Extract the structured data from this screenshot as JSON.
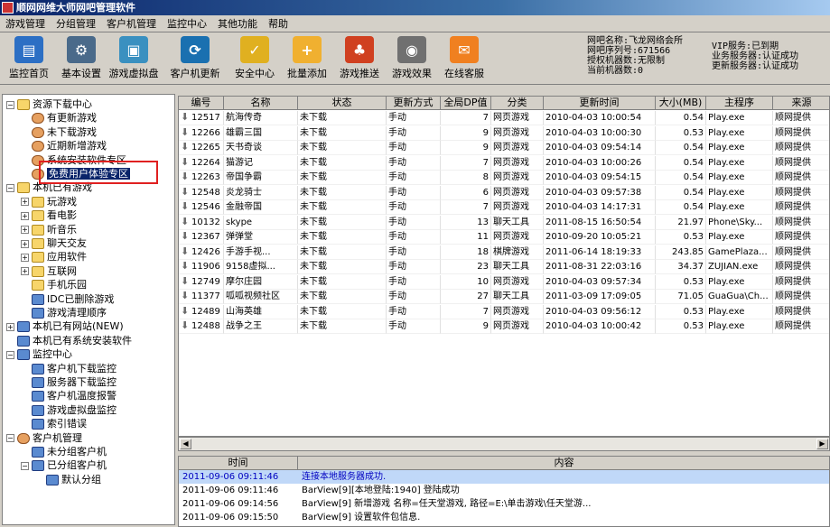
{
  "window": {
    "title": "顺网网维大师网吧管理软件"
  },
  "menu": [
    "游戏管理",
    "分组管理",
    "客户机管理",
    "监控中心",
    "其他功能",
    "帮助"
  ],
  "toolbar": [
    {
      "label": "监控首页",
      "icon": "monitor-chart-icon",
      "color": "#2c6fc4"
    },
    {
      "label": "基本设置",
      "icon": "gear-icon",
      "color": "#4a6a8a"
    },
    {
      "label": "游戏虚拟盘",
      "icon": "disk-icon",
      "color": "#3a90c0"
    },
    {
      "label": "客户机更新",
      "icon": "screen-refresh-icon",
      "color": "#1a70b0"
    },
    {
      "label": "安全中心",
      "icon": "shield-icon",
      "color": "#e0b020"
    },
    {
      "label": "批量添加",
      "icon": "folder-add-icon",
      "color": "#f0b030"
    },
    {
      "label": "游戏推送",
      "icon": "mushroom-icon",
      "color": "#d04020"
    },
    {
      "label": "游戏效果",
      "icon": "gamepad-icon",
      "color": "#707070"
    },
    {
      "label": "在线客服",
      "icon": "chat-icon",
      "color": "#f08020"
    }
  ],
  "info_left": [
    "网吧名称:飞龙网络会所",
    "网吧序列号:671566",
    "授权机器数:无限制",
    "当前机器数:0"
  ],
  "info_right": [
    "VIP服务:已到期",
    "业务服务器:认证成功",
    "更新服务器:认证成功"
  ],
  "tree": {
    "nodes": [
      {
        "label": "资源下载中心",
        "level": 0,
        "exp": "−",
        "icon": "folder"
      },
      {
        "label": "有更新游戏",
        "level": 1,
        "icon": "person"
      },
      {
        "label": "未下载游戏",
        "level": 1,
        "icon": "person"
      },
      {
        "label": "近期新增游戏",
        "level": 1,
        "icon": "person"
      },
      {
        "label": "系统安装软件专区",
        "level": 1,
        "icon": "person"
      },
      {
        "label": "免费用户体验专区",
        "level": 1,
        "icon": "person",
        "selected": true
      },
      {
        "label": "本机已有游戏",
        "level": 0,
        "exp": "−",
        "icon": "folder"
      },
      {
        "label": "玩游戏",
        "level": 1,
        "exp": "+",
        "icon": "folder"
      },
      {
        "label": "看电影",
        "level": 1,
        "exp": "+",
        "icon": "folder"
      },
      {
        "label": "听音乐",
        "level": 1,
        "exp": "+",
        "icon": "folder"
      },
      {
        "label": "聊天交友",
        "level": 1,
        "exp": "+",
        "icon": "folder"
      },
      {
        "label": "应用软件",
        "level": 1,
        "exp": "+",
        "icon": "folder"
      },
      {
        "label": "互联网",
        "level": 1,
        "exp": "+",
        "icon": "folder"
      },
      {
        "label": "手机乐园",
        "level": 1,
        "icon": "folder"
      },
      {
        "label": "IDC已删除游戏",
        "level": 1,
        "icon": "monitor"
      },
      {
        "label": "游戏清理顺序",
        "level": 1,
        "icon": "monitor"
      },
      {
        "label": "本机已有网站(NEW)",
        "level": 0,
        "exp": "+",
        "icon": "monitor"
      },
      {
        "label": "本机已有系统安装软件",
        "level": 0,
        "icon": "monitor"
      },
      {
        "label": "监控中心",
        "level": 0,
        "exp": "−",
        "icon": "monitor"
      },
      {
        "label": "客户机下载监控",
        "level": 1,
        "icon": "monitor"
      },
      {
        "label": "服务器下载监控",
        "level": 1,
        "icon": "monitor"
      },
      {
        "label": "客户机温度报警",
        "level": 1,
        "icon": "monitor"
      },
      {
        "label": "游戏虚拟盘监控",
        "level": 1,
        "icon": "monitor"
      },
      {
        "label": "索引错误",
        "level": 1,
        "icon": "monitor"
      },
      {
        "label": "客户机管理",
        "level": 0,
        "exp": "−",
        "icon": "person"
      },
      {
        "label": "未分组客户机",
        "level": 1,
        "icon": "monitor"
      },
      {
        "label": "已分组客户机",
        "level": 1,
        "exp": "−",
        "icon": "monitor"
      },
      {
        "label": "默认分组",
        "level": 2,
        "icon": "monitor"
      }
    ]
  },
  "grid": {
    "columns": [
      "编号",
      "名称",
      "状态",
      "更新方式",
      "全局DP值",
      "分类",
      "更新时间",
      "大小(MB)",
      "主程序",
      "来源"
    ],
    "rows": [
      [
        "12517",
        "航海传奇",
        "未下载",
        "手动",
        "7",
        "网页游戏",
        "2010-04-03 10:00:54",
        "0.54",
        "Play.exe",
        "顺网提供"
      ],
      [
        "12266",
        "雄霸三国",
        "未下载",
        "手动",
        "9",
        "网页游戏",
        "2010-04-03 10:00:30",
        "0.53",
        "Play.exe",
        "顺网提供"
      ],
      [
        "12265",
        "天书奇谈",
        "未下载",
        "手动",
        "9",
        "网页游戏",
        "2010-04-03 09:54:14",
        "0.54",
        "Play.exe",
        "顺网提供"
      ],
      [
        "12264",
        "猫游记",
        "未下载",
        "手动",
        "7",
        "网页游戏",
        "2010-04-03 10:00:26",
        "0.54",
        "Play.exe",
        "顺网提供"
      ],
      [
        "12263",
        "帝国争霸",
        "未下载",
        "手动",
        "8",
        "网页游戏",
        "2010-04-03 09:54:15",
        "0.54",
        "Play.exe",
        "顺网提供"
      ],
      [
        "12548",
        "炎龙骑士",
        "未下载",
        "手动",
        "6",
        "网页游戏",
        "2010-04-03 09:57:38",
        "0.54",
        "Play.exe",
        "顺网提供"
      ],
      [
        "12546",
        "金融帝国",
        "未下载",
        "手动",
        "7",
        "网页游戏",
        "2010-04-03 14:17:31",
        "0.54",
        "Play.exe",
        "顺网提供"
      ],
      [
        "10132",
        "skype",
        "未下载",
        "手动",
        "13",
        "聊天工具",
        "2011-08-15 16:50:54",
        "21.97",
        "Phone\\Sky...",
        "顺网提供"
      ],
      [
        "12367",
        "弹弹堂",
        "未下载",
        "手动",
        "11",
        "网页游戏",
        "2010-09-20 10:05:21",
        "0.53",
        "Play.exe",
        "顺网提供"
      ],
      [
        "12426",
        "手游手视...",
        "未下载",
        "手动",
        "18",
        "棋牌游戏",
        "2011-06-14 18:19:33",
        "243.85",
        "GamePlaza...",
        "顺网提供"
      ],
      [
        "11906",
        "9158虚拟...",
        "未下载",
        "手动",
        "23",
        "聊天工具",
        "2011-08-31 22:03:16",
        "34.37",
        "ZUJIAN.exe",
        "顺网提供"
      ],
      [
        "12749",
        "摩尔庄园",
        "未下载",
        "手动",
        "10",
        "网页游戏",
        "2010-04-03 09:57:34",
        "0.53",
        "Play.exe",
        "顺网提供"
      ],
      [
        "11377",
        "呱呱视频社区",
        "未下载",
        "手动",
        "27",
        "聊天工具",
        "2011-03-09 17:09:05",
        "71.05",
        "GuaGua\\Ch...",
        "顺网提供"
      ],
      [
        "12489",
        "山海英雄",
        "未下载",
        "手动",
        "7",
        "网页游戏",
        "2010-04-03 09:56:12",
        "0.53",
        "Play.exe",
        "顺网提供"
      ],
      [
        "12488",
        "战争之王",
        "未下载",
        "手动",
        "9",
        "网页游戏",
        "2010-04-03 10:00:42",
        "0.53",
        "Play.exe",
        "顺网提供"
      ]
    ]
  },
  "log": {
    "columns": [
      "时间",
      "内容"
    ],
    "rows": [
      [
        "2011-09-06 09:11:46",
        "连接本地服务器成功."
      ],
      [
        "2011-09-06 09:11:46",
        "BarView[9][本地登陆:1940] 登陆成功"
      ],
      [
        "2011-09-06 09:14:56",
        "BarView[9] 新增游戏 名称=任天堂游戏, 路径=E:\\单击游戏\\任天堂游..."
      ],
      [
        "2011-09-06 09:15:50",
        "BarView[9] 设置软件包信息."
      ]
    ]
  }
}
